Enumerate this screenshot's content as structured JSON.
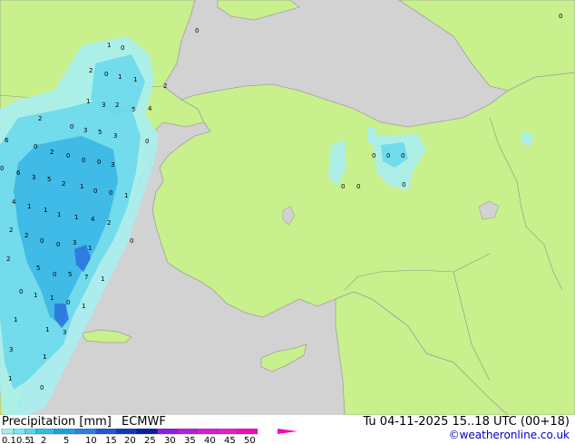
{
  "header": {
    "title": "Precipitation [mm]",
    "model": "ECMWF",
    "valid_time": "Tu 04-11-2025 15..18 UTC (00+18)",
    "credit": "©weatheronline.co.uk"
  },
  "legend": {
    "ticks": [
      "0.1",
      "0.5",
      "1",
      "2",
      "5",
      "10",
      "15",
      "20",
      "25",
      "30",
      "35",
      "40",
      "45",
      "50"
    ],
    "colors": [
      "#9ff0f0",
      "#7de6f0",
      "#55d6ee",
      "#2fbce8",
      "#1ea0e0",
      "#2f7de0",
      "#1f5ad2",
      "#1437b8",
      "#0a1f99",
      "#8c1ee0",
      "#b41edc",
      "#d21ed2",
      "#e61ec8",
      "#f00abe"
    ]
  },
  "map": {
    "colors": {
      "sea": "#d2d2d2",
      "land": "#c8f08c",
      "coast": "#a0a0a0",
      "border": "#909090",
      "precip_light": "#a8eef0",
      "precip_med": "#6cd8ec",
      "precip_heavy": "#3bb6e6",
      "precip_max": "#2c76dc"
    },
    "point_values": [
      "1",
      "0",
      "2",
      "0",
      "1",
      "1",
      "2",
      "1",
      "3",
      "2",
      "5",
      "4",
      "2",
      "0",
      "3",
      "5",
      "3",
      "6",
      "0",
      "2",
      "0",
      "0",
      "0",
      "3",
      "0",
      "6",
      "3",
      "5",
      "2",
      "1",
      "0",
      "0",
      "1",
      "4",
      "1",
      "1",
      "1",
      "1",
      "4",
      "2",
      "2",
      "2",
      "0",
      "0",
      "3",
      "1",
      "2",
      "5",
      "0",
      "5",
      "7",
      "1",
      "0",
      "1",
      "1",
      "0",
      "1",
      "1",
      "1",
      "3",
      "3",
      "1",
      "1",
      "0",
      "0",
      "0",
      "0",
      "0",
      "0",
      "0",
      "0",
      "0",
      "0",
      "0"
    ]
  }
}
